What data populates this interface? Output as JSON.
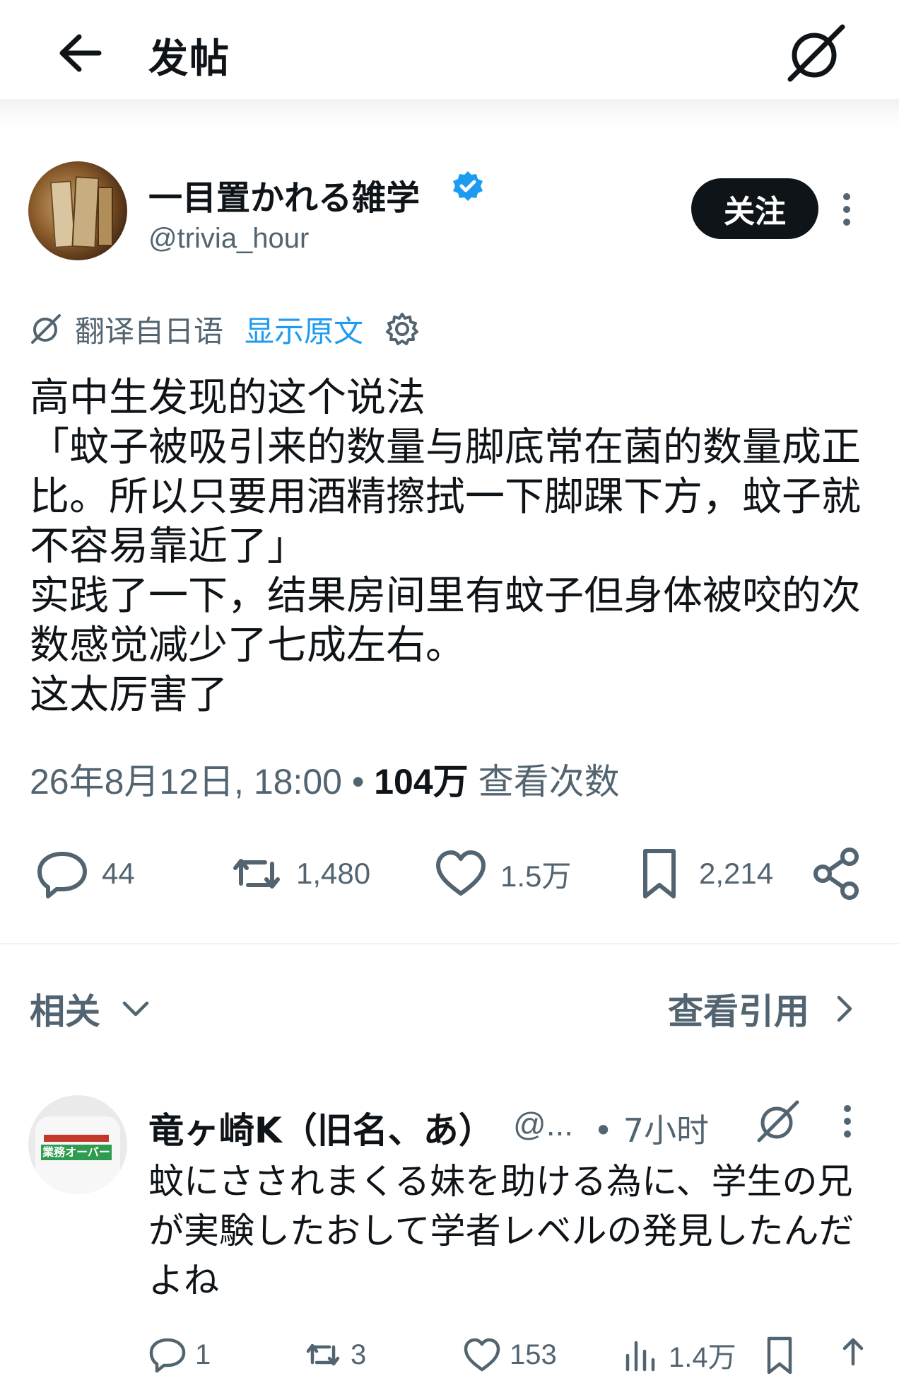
{
  "header": {
    "title": "发帖",
    "back_icon": "arrow-left-icon",
    "grok_icon": "grok-icon"
  },
  "post": {
    "author_name": "一目置かれる雑学",
    "author_handle": "@trivia_hour",
    "follow_label": "关注",
    "translation_label": "翻译自日语",
    "show_original_label": "显示原文",
    "text": "高中生发现的这个说法\n「蚊子被吸引来的数量与脚底常在菌的数量成正比。所以只要用酒精擦拭一下脚踝下方，蚊子就不容易靠近了」\n实践了一下，结果房间里有蚊子但身体被咬的次数感觉减少了七成左右。\n这太厉害了",
    "timestamp": "26年8月12日, 18:00",
    "separator": " • ",
    "views_count": "104万",
    "views_label": " 查看次数",
    "stats": {
      "replies": "44",
      "reposts": "1,480",
      "likes": "1.5万",
      "bookmarks": "2,214"
    }
  },
  "related_section": {
    "related_label": "相关",
    "view_quotes_label": "查看引用"
  },
  "reply": {
    "name": "竜ヶ崎K（旧名、あ）",
    "handle": "@...",
    "time": "• 7小时",
    "avatar_tag": "業務オーバー",
    "text": "蚊にさされまくる妹を助ける為に、学生の兄が実験したおして学者レベルの発見したんだよね",
    "stats": {
      "replies": "1",
      "reposts": "3",
      "likes": "153",
      "views": "1.4万"
    }
  },
  "colors": {
    "accent": "#1d9bf0",
    "text": "#0f1419",
    "muted": "#536471",
    "button": "#0f1419"
  }
}
